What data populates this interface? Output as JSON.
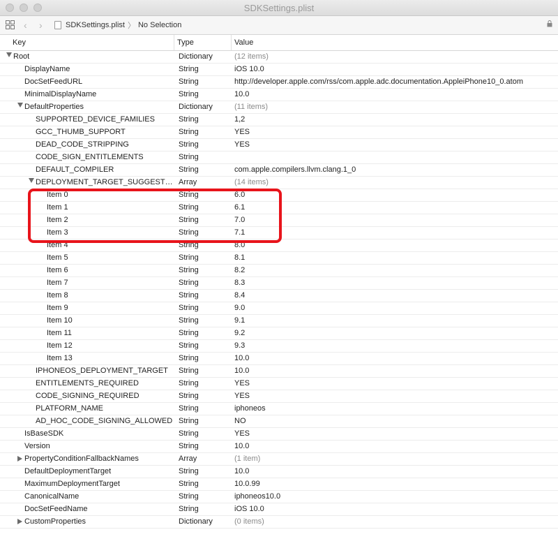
{
  "window": {
    "title": "SDKSettings.plist"
  },
  "jumpbar": {
    "file": "SDKSettings.plist",
    "separator": "〉",
    "selection": "No Selection"
  },
  "header": {
    "key": "Key",
    "type": "Type",
    "value": "Value"
  },
  "colors": {
    "highlight": "#e8141b"
  },
  "rows": [
    {
      "key": "Root",
      "type": "Dictionary",
      "value": "(12 items)",
      "level": 0,
      "disclosure": "down",
      "count": true
    },
    {
      "key": "DisplayName",
      "type": "String",
      "value": "iOS 10.0",
      "level": 1
    },
    {
      "key": "DocSetFeedURL",
      "type": "String",
      "value": "http://developer.apple.com/rss/com.apple.adc.documentation.AppleiPhone10_0.atom",
      "level": 1
    },
    {
      "key": "MinimalDisplayName",
      "type": "String",
      "value": "10.0",
      "level": 1
    },
    {
      "key": "DefaultProperties",
      "type": "Dictionary",
      "value": "(11 items)",
      "level": 1,
      "disclosure": "down",
      "count": true
    },
    {
      "key": "SUPPORTED_DEVICE_FAMILIES",
      "type": "String",
      "value": "1,2",
      "level": 2
    },
    {
      "key": "GCC_THUMB_SUPPORT",
      "type": "String",
      "value": "YES",
      "level": 2
    },
    {
      "key": "DEAD_CODE_STRIPPING",
      "type": "String",
      "value": "YES",
      "level": 2
    },
    {
      "key": "CODE_SIGN_ENTITLEMENTS",
      "type": "String",
      "value": "",
      "level": 2
    },
    {
      "key": "DEFAULT_COMPILER",
      "type": "String",
      "value": "com.apple.compilers.llvm.clang.1_0",
      "level": 2
    },
    {
      "key": "DEPLOYMENT_TARGET_SUGGESTE...",
      "type": "Array",
      "value": "(14 items)",
      "level": 2,
      "disclosure": "down",
      "count": true
    },
    {
      "key": "Item 0",
      "type": "String",
      "value": "6.0",
      "level": 3
    },
    {
      "key": "Item 1",
      "type": "String",
      "value": "6.1",
      "level": 3
    },
    {
      "key": "Item 2",
      "type": "String",
      "value": "7.0",
      "level": 3
    },
    {
      "key": "Item 3",
      "type": "String",
      "value": "7.1",
      "level": 3
    },
    {
      "key": "Item 4",
      "type": "String",
      "value": "8.0",
      "level": 3
    },
    {
      "key": "Item 5",
      "type": "String",
      "value": "8.1",
      "level": 3
    },
    {
      "key": "Item 6",
      "type": "String",
      "value": "8.2",
      "level": 3
    },
    {
      "key": "Item 7",
      "type": "String",
      "value": "8.3",
      "level": 3
    },
    {
      "key": "Item 8",
      "type": "String",
      "value": "8.4",
      "level": 3
    },
    {
      "key": "Item 9",
      "type": "String",
      "value": "9.0",
      "level": 3
    },
    {
      "key": "Item 10",
      "type": "String",
      "value": "9.1",
      "level": 3
    },
    {
      "key": "Item 11",
      "type": "String",
      "value": "9.2",
      "level": 3
    },
    {
      "key": "Item 12",
      "type": "String",
      "value": "9.3",
      "level": 3
    },
    {
      "key": "Item 13",
      "type": "String",
      "value": "10.0",
      "level": 3
    },
    {
      "key": "IPHONEOS_DEPLOYMENT_TARGET",
      "type": "String",
      "value": "10.0",
      "level": 2
    },
    {
      "key": "ENTITLEMENTS_REQUIRED",
      "type": "String",
      "value": "YES",
      "level": 2
    },
    {
      "key": "CODE_SIGNING_REQUIRED",
      "type": "String",
      "value": "YES",
      "level": 2
    },
    {
      "key": "PLATFORM_NAME",
      "type": "String",
      "value": "iphoneos",
      "level": 2
    },
    {
      "key": "AD_HOC_CODE_SIGNING_ALLOWED",
      "type": "String",
      "value": "NO",
      "level": 2
    },
    {
      "key": "IsBaseSDK",
      "type": "String",
      "value": "YES",
      "level": 1
    },
    {
      "key": "Version",
      "type": "String",
      "value": "10.0",
      "level": 1
    },
    {
      "key": "PropertyConditionFallbackNames",
      "type": "Array",
      "value": "(1 item)",
      "level": 1,
      "disclosure": "right",
      "count": true
    },
    {
      "key": "DefaultDeploymentTarget",
      "type": "String",
      "value": "10.0",
      "level": 1
    },
    {
      "key": "MaximumDeploymentTarget",
      "type": "String",
      "value": "10.0.99",
      "level": 1
    },
    {
      "key": "CanonicalName",
      "type": "String",
      "value": "iphoneos10.0",
      "level": 1
    },
    {
      "key": "DocSetFeedName",
      "type": "String",
      "value": "iOS 10.0",
      "level": 1
    },
    {
      "key": "CustomProperties",
      "type": "Dictionary",
      "value": "(0 items)",
      "level": 1,
      "disclosure": "right",
      "count": true
    }
  ]
}
